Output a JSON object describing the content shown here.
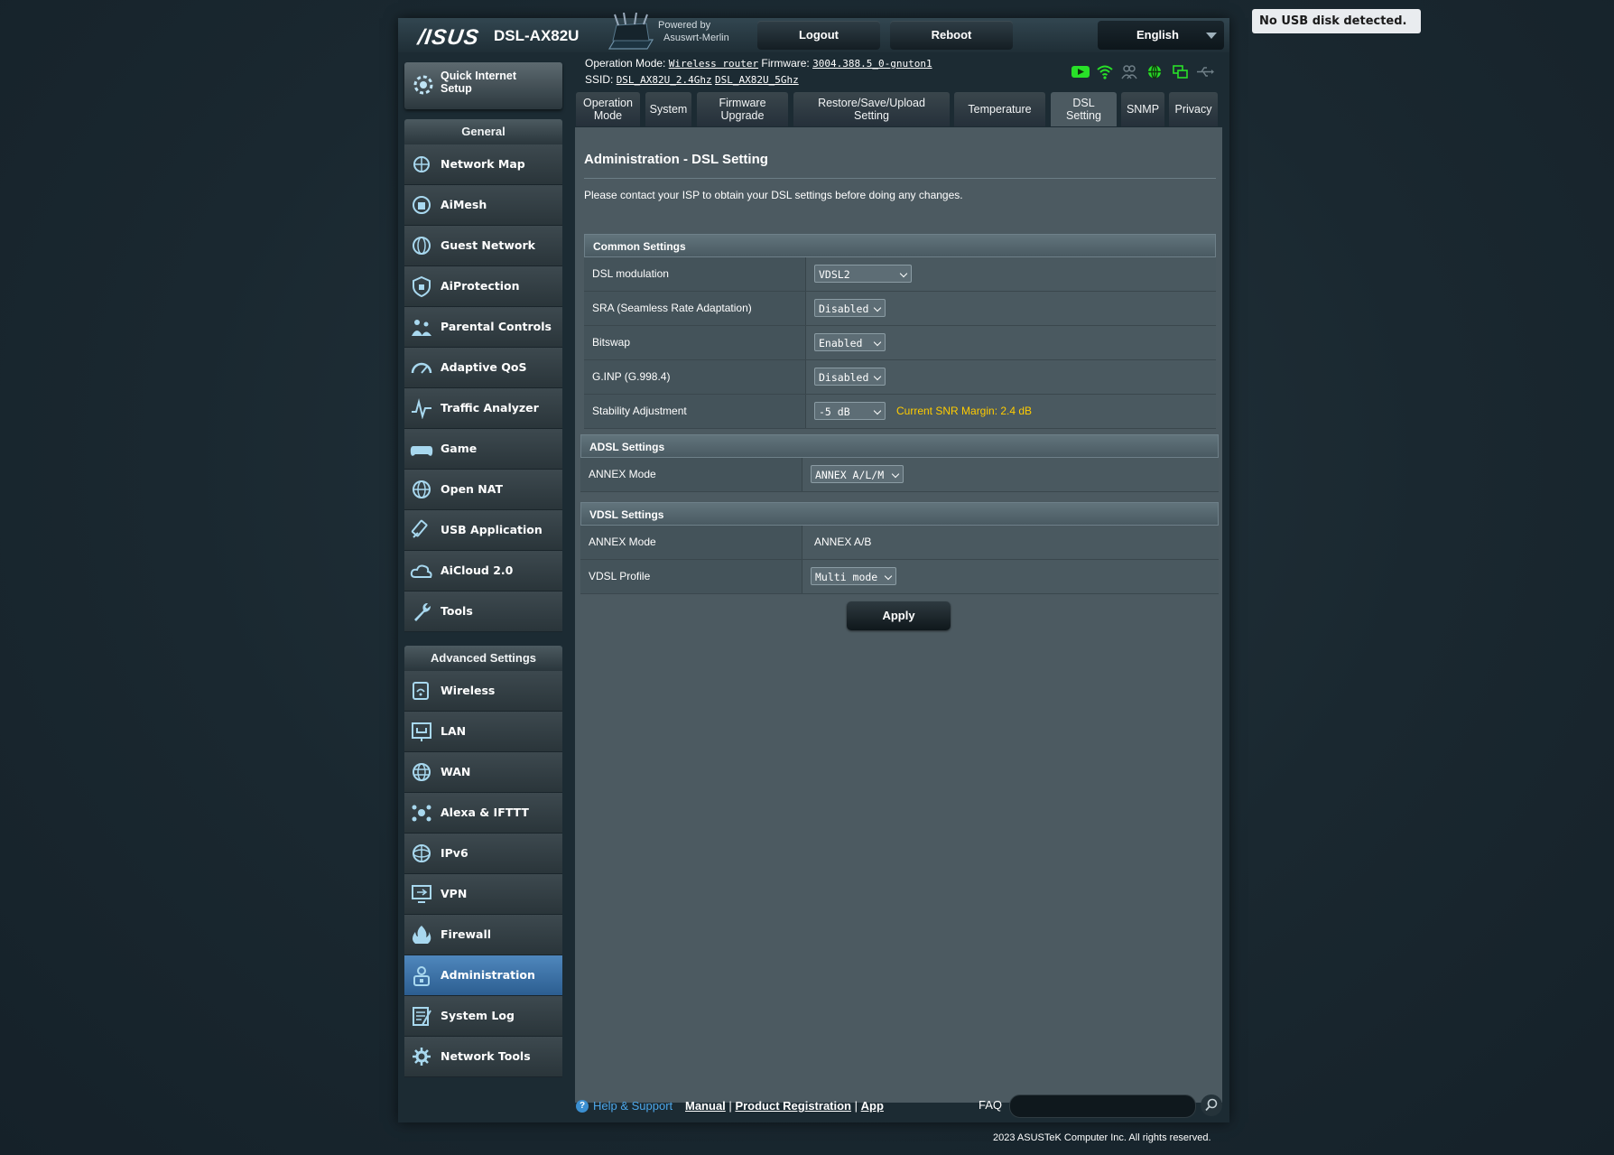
{
  "usb_notice": "No USB disk detected.",
  "header": {
    "brand": "/ISUS",
    "model": "DSL-AX82U",
    "powered_by_1": "Powered by",
    "powered_by_2": "Asuswrt-Merlin",
    "logout": "Logout",
    "reboot": "Reboot",
    "language": "English"
  },
  "status": {
    "op_mode_label": "Operation Mode:",
    "op_mode_value": "Wireless router",
    "firmware_label": "Firmware:",
    "firmware_value": "3004.388.5_0-gnuton1",
    "ssid_label": "SSID:",
    "ssid_24": "DSL_AX82U_2.4Ghz",
    "ssid_5": "DSL_AX82U_5Ghz",
    "icons": [
      "app-icon",
      "wifi-icon",
      "clients-icon",
      "internet-icon",
      "devices-icon",
      "usb-icon"
    ]
  },
  "sidebar": {
    "quick_setup_1": "Quick Internet",
    "quick_setup_2": "Setup",
    "general_title": "General",
    "general": [
      {
        "label": "Network Map",
        "icon": "network-map-icon"
      },
      {
        "label": "AiMesh",
        "icon": "aimesh-icon"
      },
      {
        "label": "Guest Network",
        "icon": "guest-network-icon"
      },
      {
        "label": "AiProtection",
        "icon": "shield-icon"
      },
      {
        "label": "Parental Controls",
        "icon": "parental-icon"
      },
      {
        "label": "Adaptive QoS",
        "icon": "gauge-icon"
      },
      {
        "label": "Traffic Analyzer",
        "icon": "traffic-icon"
      },
      {
        "label": "Game",
        "icon": "gamepad-icon"
      },
      {
        "label": "Open NAT",
        "icon": "globe-icon"
      },
      {
        "label": "USB Application",
        "icon": "usb-app-icon"
      },
      {
        "label": "AiCloud 2.0",
        "icon": "cloud-icon"
      },
      {
        "label": "Tools",
        "icon": "wrench-icon"
      }
    ],
    "advanced_title": "Advanced Settings",
    "advanced": [
      {
        "label": "Wireless",
        "icon": "wireless-icon"
      },
      {
        "label": "LAN",
        "icon": "lan-icon"
      },
      {
        "label": "WAN",
        "icon": "wan-icon"
      },
      {
        "label": "Alexa & IFTTT",
        "icon": "alexa-icon"
      },
      {
        "label": "IPv6",
        "icon": "ipv6-icon"
      },
      {
        "label": "VPN",
        "icon": "vpn-icon"
      },
      {
        "label": "Firewall",
        "icon": "firewall-icon"
      },
      {
        "label": "Administration",
        "icon": "admin-icon",
        "active": true
      },
      {
        "label": "System Log",
        "icon": "syslog-icon"
      },
      {
        "label": "Network Tools",
        "icon": "gear-icon"
      }
    ]
  },
  "tabs": [
    {
      "line1": "Operation",
      "line2": "Mode"
    },
    {
      "line1": "System",
      "line2": ""
    },
    {
      "line1": "Firmware",
      "line2": "Upgrade"
    },
    {
      "line1": "Restore/Save/Upload",
      "line2": "Setting"
    },
    {
      "line1": "Temperature",
      "line2": ""
    },
    {
      "line1": "DSL",
      "line2": "Setting",
      "active": true
    },
    {
      "line1": "SNMP",
      "line2": ""
    },
    {
      "line1": "Privacy",
      "line2": ""
    }
  ],
  "main": {
    "title": "Administration - DSL Setting",
    "notice": "Please contact your ISP to obtain your DSL settings before doing any changes.",
    "common": {
      "title": "Common Settings",
      "rows": [
        {
          "label": "DSL modulation",
          "value": "VDSL2"
        },
        {
          "label": "SRA (Seamless Rate Adaptation)",
          "value": "Disabled"
        },
        {
          "label": "Bitswap",
          "value": "Enabled"
        },
        {
          "label": "G.INP (G.998.4)",
          "value": "Disabled"
        },
        {
          "label": "Stability Adjustment",
          "value": "-5 dB"
        }
      ],
      "snr_margin": "Current SNR Margin: 2.4 dB"
    },
    "adsl": {
      "title": "ADSL Settings",
      "annex_label": "ANNEX Mode",
      "annex_value": "ANNEX A/L/M"
    },
    "vdsl": {
      "title": "VDSL Settings",
      "annex_label": "ANNEX Mode",
      "annex_value": "ANNEX A/B",
      "profile_label": "VDSL Profile",
      "profile_value": "Multi mode"
    },
    "apply": "Apply"
  },
  "footer": {
    "help_icon": "?",
    "help": "Help & Support",
    "manual": "Manual",
    "sep": "|",
    "product_reg": "Product Registration",
    "app": "App",
    "faq": "FAQ",
    "copyright": "2023 ASUSTeK Computer Inc. All rights reserved."
  }
}
